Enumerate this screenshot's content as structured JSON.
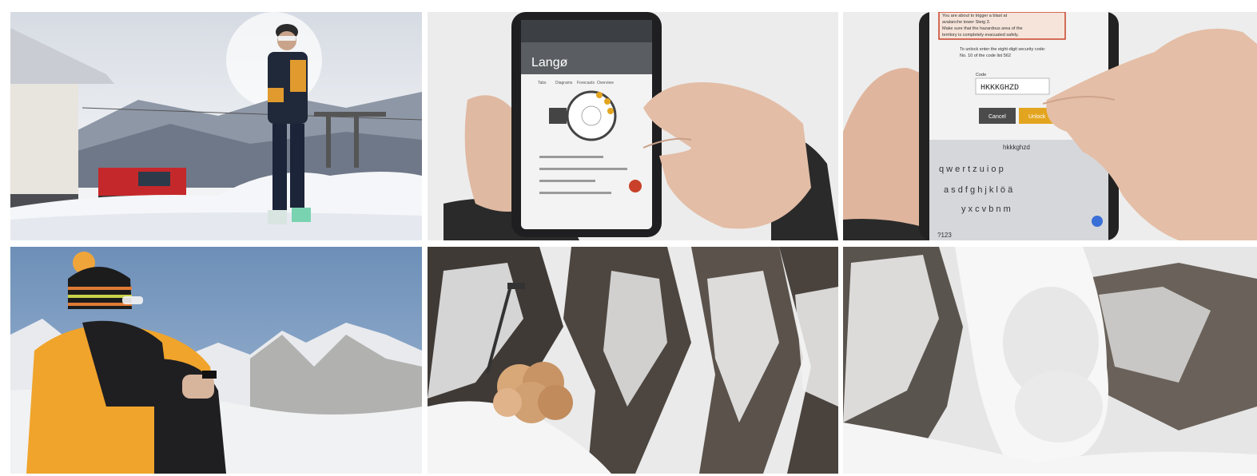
{
  "grid": {
    "tiles": [
      {
        "id": "skier-with-phone"
      },
      {
        "id": "phone-app-dial"
      },
      {
        "id": "phone-code-entry"
      },
      {
        "id": "skier-mountain-view"
      },
      {
        "id": "explosion-on-slope"
      },
      {
        "id": "avalanche-release"
      }
    ]
  },
  "app_screen": {
    "title": "Langø",
    "tabs": [
      "Tabs",
      "Diagrams",
      "Forecasts",
      "Overview"
    ]
  },
  "code_screen": {
    "warning_line1": "You are about to trigger a blast at",
    "warning_line2": "avalanche tower Steig 3.",
    "warning_line3": "Make sure that the hazardous area of the",
    "warning_line4": "territory is completely evacuated safely.",
    "prompt_line1": "To unlock enter the eight-digit security code:",
    "prompt_line2": "No. 10 of the code list 562",
    "code_label": "Code",
    "code_value": "HKKKGHZD",
    "cancel_label": "Cancel",
    "confirm_label": "Unlock",
    "suggestion": "hkkkghzd",
    "keyboard_row1": "q w e r t z u i o p",
    "keyboard_row2": "a s d f g h j k l ö ä",
    "keyboard_row3": "y x c v b n m",
    "keyboard_mode": "?123"
  },
  "colors": {
    "accent_orange": "#e3a51f",
    "danger_red": "#c9412a"
  }
}
